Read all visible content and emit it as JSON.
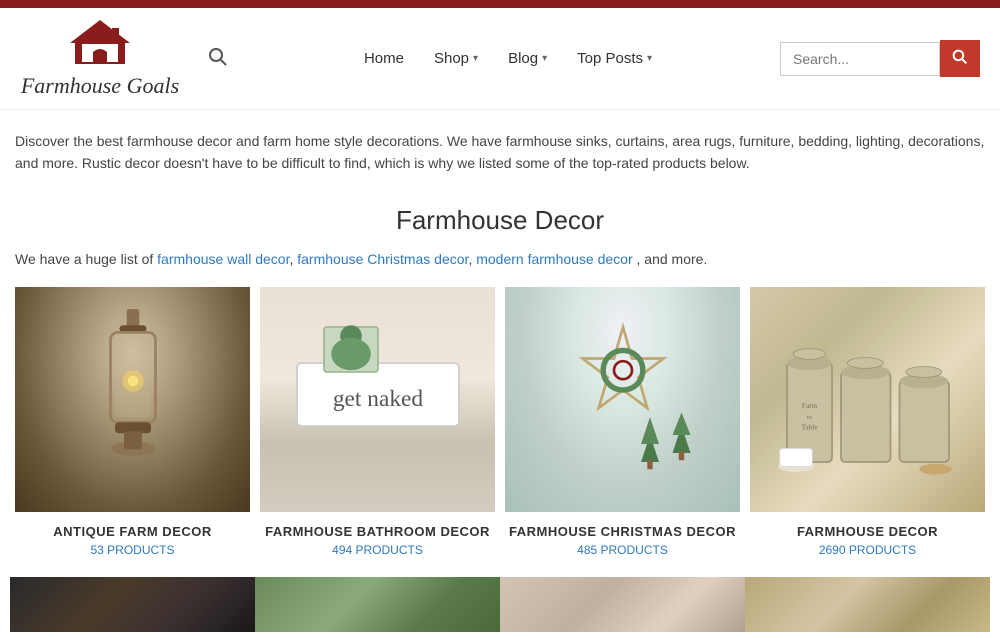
{
  "topbar": {},
  "header": {
    "logo_text": "Farmhouse Goals",
    "nav": {
      "home": "Home",
      "shop": "Shop",
      "blog": "Blog",
      "top_posts": "Top Posts"
    },
    "search_placeholder": "Search..."
  },
  "hero": {
    "text": "Discover the best farmhouse decor and farm home style decorations. We have farmhouse sinks, curtains, area rugs, furniture, bedding, lighting, decorations, and more. Rustic decor doesn't have to be difficult to find, which is why we listed some of the top-rated products below."
  },
  "section": {
    "heading": "Farmhouse Decor",
    "links_prefix": "We have a huge list of",
    "links": [
      {
        "text": "farmhouse wall decor",
        "href": "#"
      },
      {
        "text": "farmhouse Christmas decor",
        "href": "#"
      },
      {
        "text": "modern farmhouse decor",
        "href": "#"
      }
    ],
    "links_suffix": ", and more."
  },
  "products": [
    {
      "title": "ANTIQUE FARM DECOR",
      "count": "53 PRODUCTS"
    },
    {
      "title": "FARMHOUSE BATHROOM DECOR",
      "count": "494 PRODUCTS"
    },
    {
      "title": "FARMHOUSE CHRISTMAS DECOR",
      "count": "485 PRODUCTS"
    },
    {
      "title": "FARMHOUSE DECOR",
      "count": "2690 PRODUCTS"
    }
  ]
}
